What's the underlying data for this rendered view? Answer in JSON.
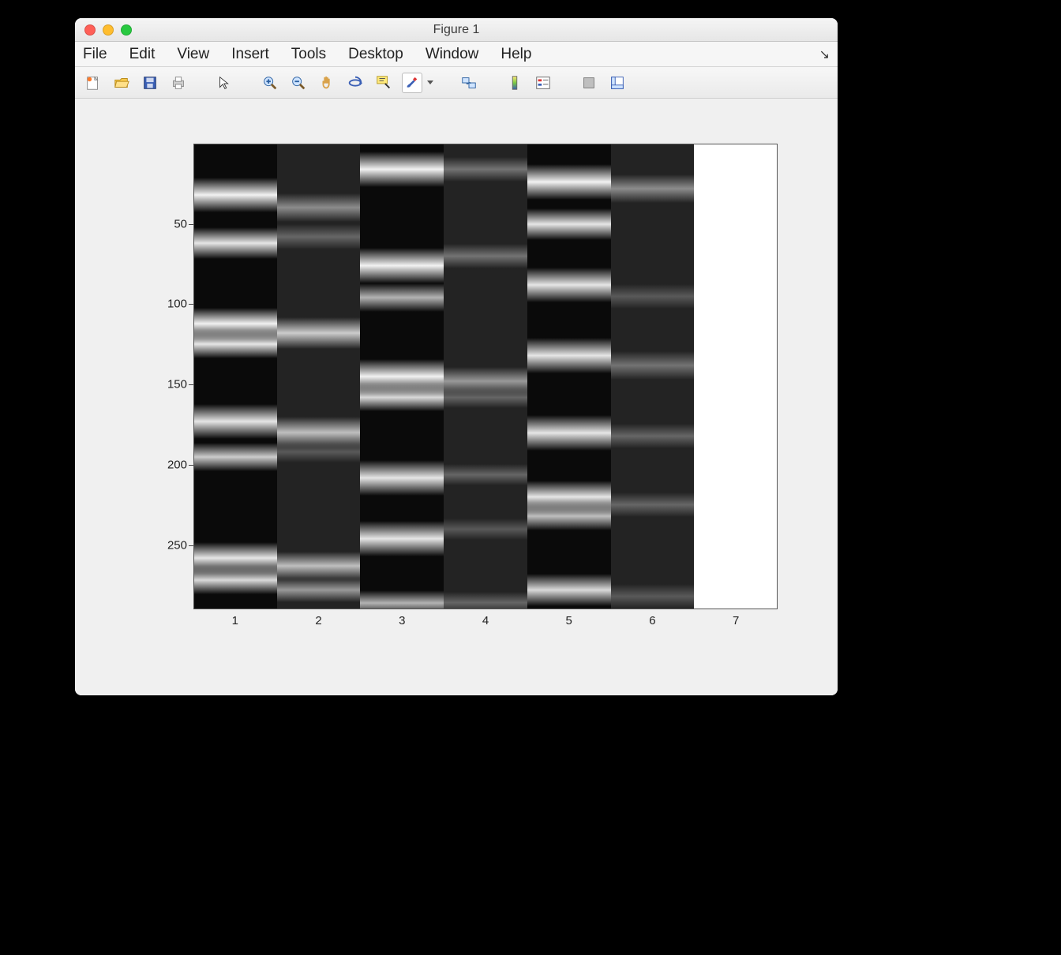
{
  "window": {
    "title": "Figure 1"
  },
  "menubar": {
    "items": [
      "File",
      "Edit",
      "View",
      "Insert",
      "Tools",
      "Desktop",
      "Window",
      "Help"
    ]
  },
  "toolbar": {
    "icons": [
      "new-figure",
      "open",
      "save",
      "print",
      "pointer",
      "zoom-in",
      "zoom-out",
      "pan",
      "rotate3d",
      "data-cursor",
      "brush",
      "link",
      "colorbar",
      "legend",
      "hide-tools",
      "float"
    ]
  },
  "chart_data": {
    "type": "heatmap",
    "xlabel": "",
    "ylabel": "",
    "xticks": [
      1,
      2,
      3,
      4,
      5,
      6,
      7
    ],
    "yticks": [
      50,
      100,
      150,
      200,
      250
    ],
    "ylim": [
      0,
      290
    ],
    "n_lanes": 7,
    "lane_bg": [
      "dark",
      "med",
      "dark",
      "med",
      "dark",
      "med",
      "white"
    ],
    "lanes": [
      {
        "idx": 1,
        "bands": [
          {
            "y": 32,
            "w": 10,
            "a": 0.95
          },
          {
            "y": 62,
            "w": 9,
            "a": 0.9
          },
          {
            "y": 112,
            "w": 9,
            "a": 0.95
          },
          {
            "y": 125,
            "w": 8,
            "a": 0.9
          },
          {
            "y": 173,
            "w": 10,
            "a": 0.9
          },
          {
            "y": 195,
            "w": 8,
            "a": 0.8
          },
          {
            "y": 258,
            "w": 9,
            "a": 0.9
          },
          {
            "y": 272,
            "w": 8,
            "a": 0.85
          }
        ]
      },
      {
        "idx": 2,
        "bands": [
          {
            "y": 40,
            "w": 8,
            "a": 0.55
          },
          {
            "y": 58,
            "w": 7,
            "a": 0.4
          },
          {
            "y": 118,
            "w": 9,
            "a": 0.8
          },
          {
            "y": 180,
            "w": 9,
            "a": 0.75
          },
          {
            "y": 192,
            "w": 6,
            "a": 0.35
          },
          {
            "y": 263,
            "w": 8,
            "a": 0.75
          },
          {
            "y": 278,
            "w": 7,
            "a": 0.6
          }
        ]
      },
      {
        "idx": 3,
        "bands": [
          {
            "y": 16,
            "w": 10,
            "a": 0.95
          },
          {
            "y": 76,
            "w": 10,
            "a": 0.95
          },
          {
            "y": 96,
            "w": 8,
            "a": 0.7
          },
          {
            "y": 145,
            "w": 10,
            "a": 0.95
          },
          {
            "y": 158,
            "w": 8,
            "a": 0.85
          },
          {
            "y": 208,
            "w": 10,
            "a": 0.9
          },
          {
            "y": 246,
            "w": 10,
            "a": 0.9
          },
          {
            "y": 286,
            "w": 7,
            "a": 0.7
          }
        ]
      },
      {
        "idx": 4,
        "bands": [
          {
            "y": 16,
            "w": 7,
            "a": 0.45
          },
          {
            "y": 70,
            "w": 7,
            "a": 0.45
          },
          {
            "y": 148,
            "w": 8,
            "a": 0.6
          },
          {
            "y": 158,
            "w": 6,
            "a": 0.4
          },
          {
            "y": 206,
            "w": 6,
            "a": 0.4
          },
          {
            "y": 240,
            "w": 6,
            "a": 0.35
          },
          {
            "y": 286,
            "w": 6,
            "a": 0.4
          }
        ]
      },
      {
        "idx": 5,
        "bands": [
          {
            "y": 24,
            "w": 10,
            "a": 0.95
          },
          {
            "y": 50,
            "w": 9,
            "a": 0.9
          },
          {
            "y": 88,
            "w": 10,
            "a": 0.9
          },
          {
            "y": 132,
            "w": 10,
            "a": 0.9
          },
          {
            "y": 180,
            "w": 10,
            "a": 0.9
          },
          {
            "y": 220,
            "w": 9,
            "a": 0.9
          },
          {
            "y": 232,
            "w": 8,
            "a": 0.75
          },
          {
            "y": 278,
            "w": 9,
            "a": 0.85
          }
        ]
      },
      {
        "idx": 6,
        "bands": [
          {
            "y": 28,
            "w": 8,
            "a": 0.55
          },
          {
            "y": 95,
            "w": 7,
            "a": 0.35
          },
          {
            "y": 138,
            "w": 8,
            "a": 0.45
          },
          {
            "y": 182,
            "w": 7,
            "a": 0.4
          },
          {
            "y": 225,
            "w": 7,
            "a": 0.4
          },
          {
            "y": 282,
            "w": 7,
            "a": 0.35
          }
        ]
      },
      {
        "idx": 7,
        "bands": []
      }
    ]
  }
}
